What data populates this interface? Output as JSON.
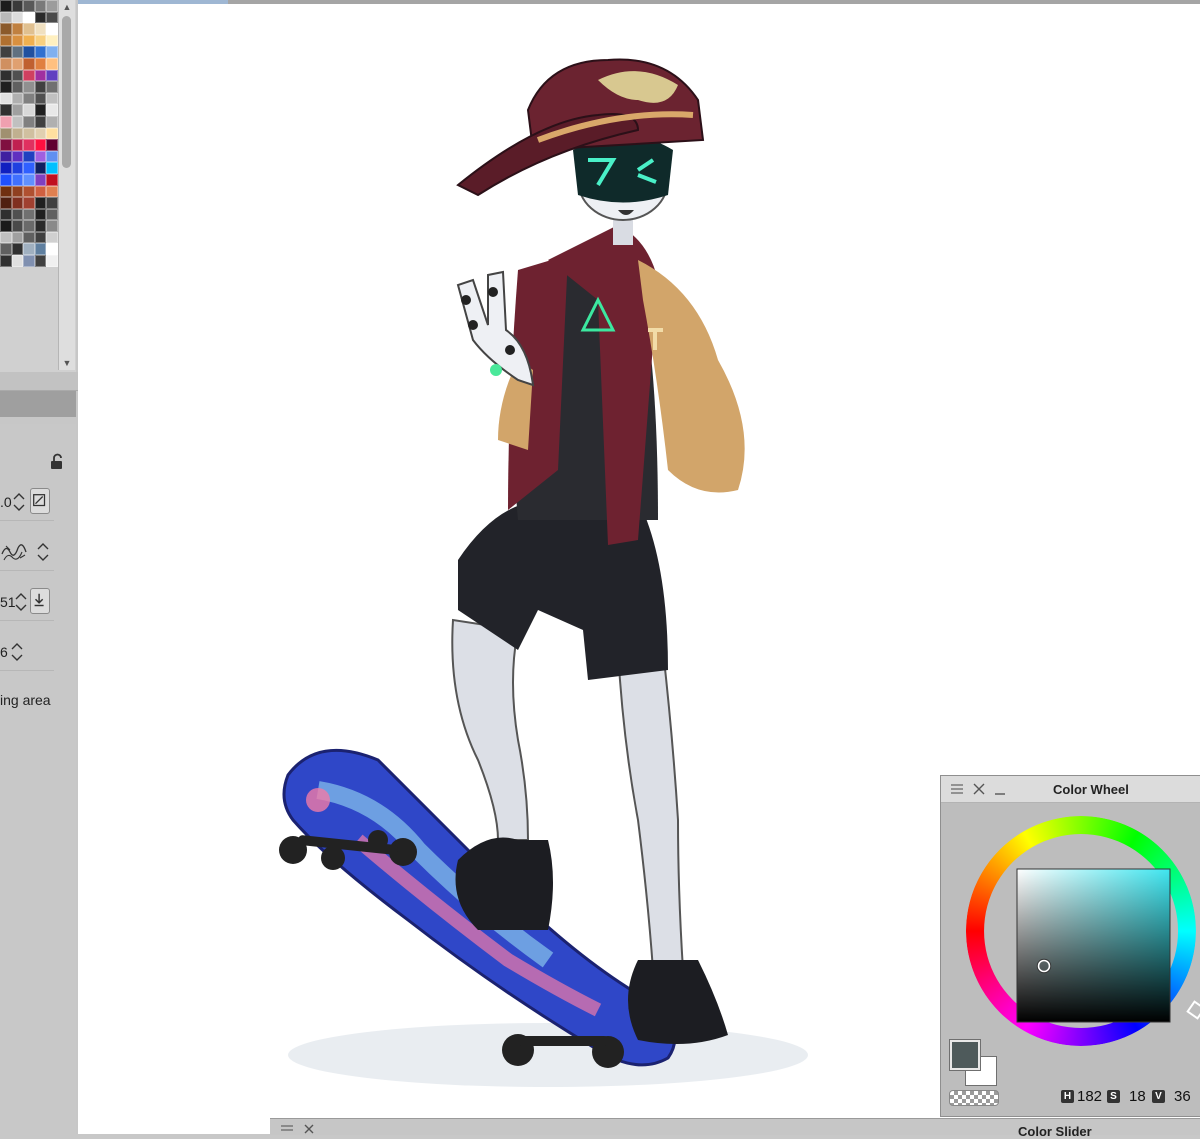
{
  "swatch_palette": {
    "colors": [
      "#1c1c1c",
      "#3a3a3a",
      "#595959",
      "#7a7a7a",
      "#9c9c9c",
      "#b9b9b9",
      "#dcdcdc",
      "#ffffff",
      "#2a2a2a",
      "#4a4a4a",
      "#8b5a2b",
      "#c08040",
      "#e0c090",
      "#f0e0c0",
      "#ffffff",
      "#b07030",
      "#d89040",
      "#f0b050",
      "#f8d080",
      "#fff0c0",
      "#404040",
      "#607080",
      "#2050a0",
      "#3070d0",
      "#80b0f0",
      "#d09060",
      "#e0a070",
      "#c06030",
      "#e08040",
      "#ffc080",
      "#303030",
      "#505050",
      "#d04060",
      "#a030a0",
      "#6040c0",
      "#202020",
      "#606060",
      "#909090",
      "#404040",
      "#707070",
      "#e0e0e0",
      "#b0b0b0",
      "#808080",
      "#505050",
      "#c0c0c0",
      "#303030",
      "#a0a0a0",
      "#d8d8d8",
      "#202020",
      "#e8e8e8",
      "#f0a0b0",
      "#c0c0c0",
      "#808080",
      "#404040",
      "#b0b0b0",
      "#a09070",
      "#c0b090",
      "#d0c0a0",
      "#e0d0b0",
      "#ffe0a0",
      "#801040",
      "#c02050",
      "#e03060",
      "#ff1040",
      "#600030",
      "#4020a0",
      "#6030c0",
      "#2040c0",
      "#a060e0",
      "#6090f0",
      "#1020c0",
      "#2040e0",
      "#3060ff",
      "#102060",
      "#00c0ff",
      "#2050ff",
      "#4070ff",
      "#6090ff",
      "#8040c0",
      "#c01020",
      "#703010",
      "#904020",
      "#b05030",
      "#d06040",
      "#e08050",
      "#502010",
      "#803020",
      "#a04030",
      "#202020",
      "#404040",
      "#303030",
      "#505050",
      "#707070",
      "#202020",
      "#606060",
      "#1a1a1a",
      "#4a4a4a",
      "#6a6a6a",
      "#2a2a2a",
      "#8a8a8a",
      "#c0c0c0",
      "#a0a0a0",
      "#606060",
      "#404040",
      "#d0d0d0",
      "#606060",
      "#303030",
      "#a0b0c0",
      "#6080a0",
      "#ffffff",
      "#303030",
      "#e0e0e0",
      "#8090b0",
      "#404040",
      "#f0f0f0"
    ]
  },
  "tool_property": {
    "rows": [
      {
        "value": ".0",
        "button_icon": "slash-square-icon"
      },
      {
        "value": "",
        "button_icon": "brush-texture-icon"
      },
      {
        "value": "51",
        "button_icon": "download-icon"
      },
      {
        "value": "6",
        "button_icon": ""
      }
    ],
    "area_label": "ing area"
  },
  "color_wheel": {
    "title": "Color Wheel",
    "main_color": "#4e5a5b",
    "sub_color": "#ffffff",
    "hue_label": "H",
    "hue": "182",
    "sat_label": "S",
    "saturation": "18",
    "val_label": "V",
    "value": "36",
    "square_base_hue_color": "#3fe6f0"
  },
  "color_slider": {
    "title": "Color Slider"
  }
}
